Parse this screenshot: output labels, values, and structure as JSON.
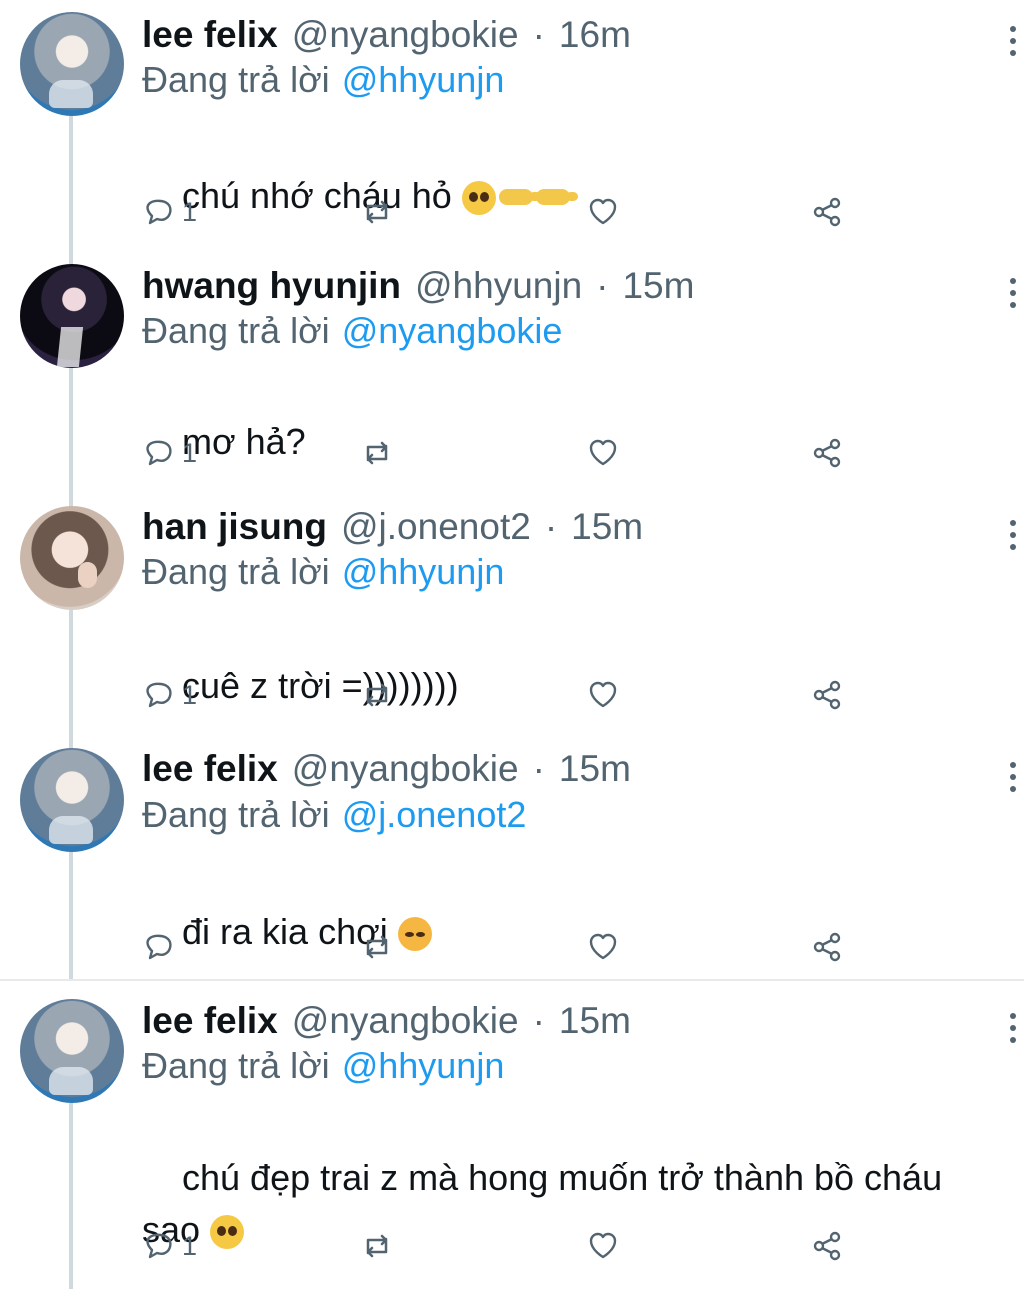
{
  "tweets": [
    {
      "name": "lee felix",
      "handle": "@nyangbokie",
      "separator": "·",
      "time": "16m",
      "reply_prefix": "Đang trả lời",
      "reply_to": "@hhyunjn",
      "text": "chú nhớ cháu hỏ",
      "emoji": [
        "pleading-face",
        "backhand-index-pointing-right",
        "backhand-index-pointing-left"
      ],
      "reply_count": "1"
    },
    {
      "name": "hwang hyunjin",
      "handle": "@hhyunjn",
      "separator": "·",
      "time": "15m",
      "reply_prefix": "Đang trả lời",
      "reply_to": "@nyangbokie",
      "text": "mơ hả?",
      "reply_count": "1"
    },
    {
      "name": "han jisung",
      "handle": "@j.onenot2",
      "separator": "·",
      "time": "15m",
      "reply_prefix": "Đang trả lời",
      "reply_to": "@hhyunjn",
      "text": "cuê z trời =))))))))",
      "reply_count": "1"
    },
    {
      "name": "lee felix",
      "handle": "@nyangbokie",
      "separator": "·",
      "time": "15m",
      "reply_prefix": "Đang trả lời",
      "reply_to": "@j.onenot2",
      "text": "đi ra kia chơi",
      "emoji": [
        "pouting-face"
      ],
      "reply_count": ""
    },
    {
      "name": "lee felix",
      "handle": "@nyangbokie",
      "separator": "·",
      "time": "15m",
      "reply_prefix": "Đang trả lời",
      "reply_to": "@hhyunjn",
      "text": "chú đẹp trai z mà hong muốn trở thành bồ cháu\nsao",
      "emoji": [
        "pleading-face"
      ],
      "reply_count": "1"
    }
  ],
  "icons": {
    "reply": "reply-icon",
    "retweet": "retweet-icon",
    "like": "heart-icon",
    "share": "share-icon",
    "more": "more-icon"
  },
  "colors": {
    "text": "#0f1419",
    "secondary": "#536471",
    "link": "#1d9bf0",
    "thread_line": "#cfd9de",
    "divider": "#e7e9ea"
  }
}
